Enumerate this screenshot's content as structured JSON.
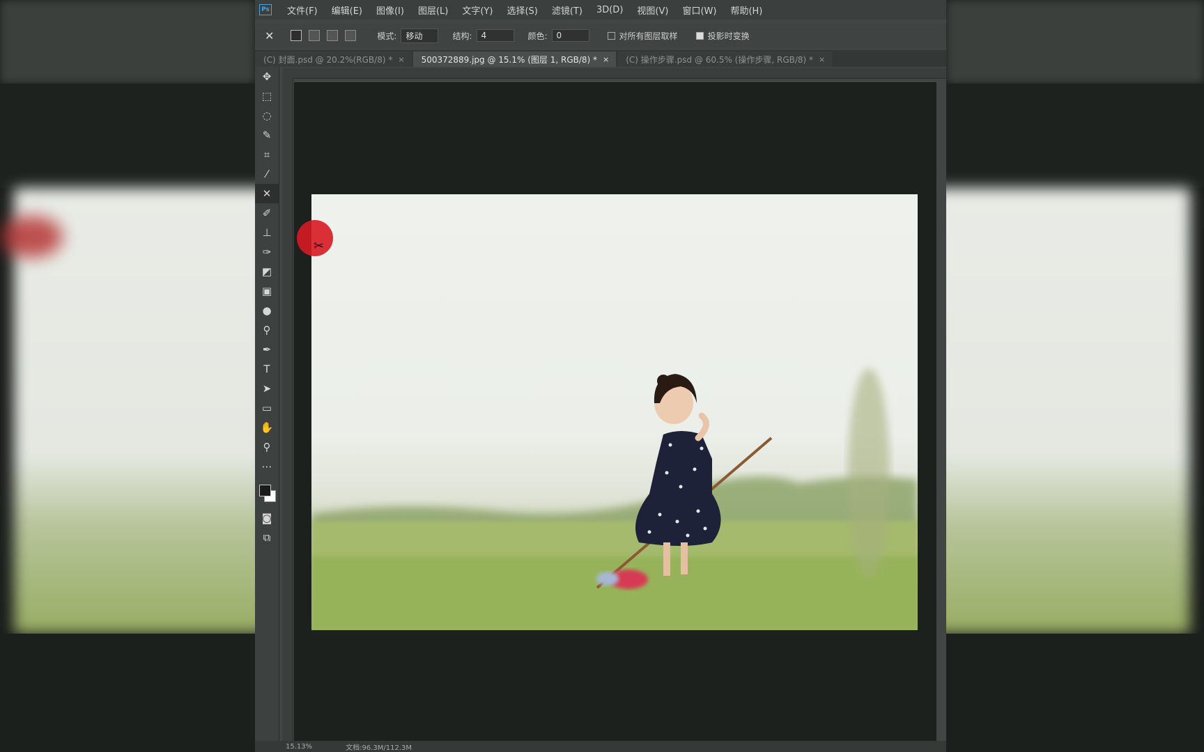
{
  "menu": {
    "app_icon": "Ps",
    "items": [
      "文件(F)",
      "编辑(E)",
      "图像(I)",
      "图层(L)",
      "文字(Y)",
      "选择(S)",
      "滤镜(T)",
      "3D(D)",
      "视图(V)",
      "窗口(W)",
      "帮助(H)"
    ]
  },
  "options": {
    "tool_icon": "content-aware-move-icon",
    "mode_label": "模式:",
    "mode_value": "移动",
    "structure_label": "结构:",
    "structure_value": "4",
    "color_label": "颜色:",
    "color_value": "0",
    "sample_all_label": "对所有图层取样",
    "transform_on_drop_label": "投影时变换"
  },
  "tabs": [
    {
      "label": "(C) 封面.psd @ 20.2%(RGB/8) *",
      "active": false
    },
    {
      "label": "500372889.jpg @ 15.1% (图层 1, RGB/8) *",
      "active": true
    },
    {
      "label": "(C) 操作步骤.psd @ 60.5% (操作步骤, RGB/8) *",
      "active": false
    }
  ],
  "tab_close": "×",
  "status": {
    "zoom": "15.13%",
    "doc": "文档:96.3M/112.3M"
  },
  "colors": {
    "accent_cursor": "#d71923",
    "canvas_bg": "#1c211d",
    "chrome_bg": "#414543"
  }
}
